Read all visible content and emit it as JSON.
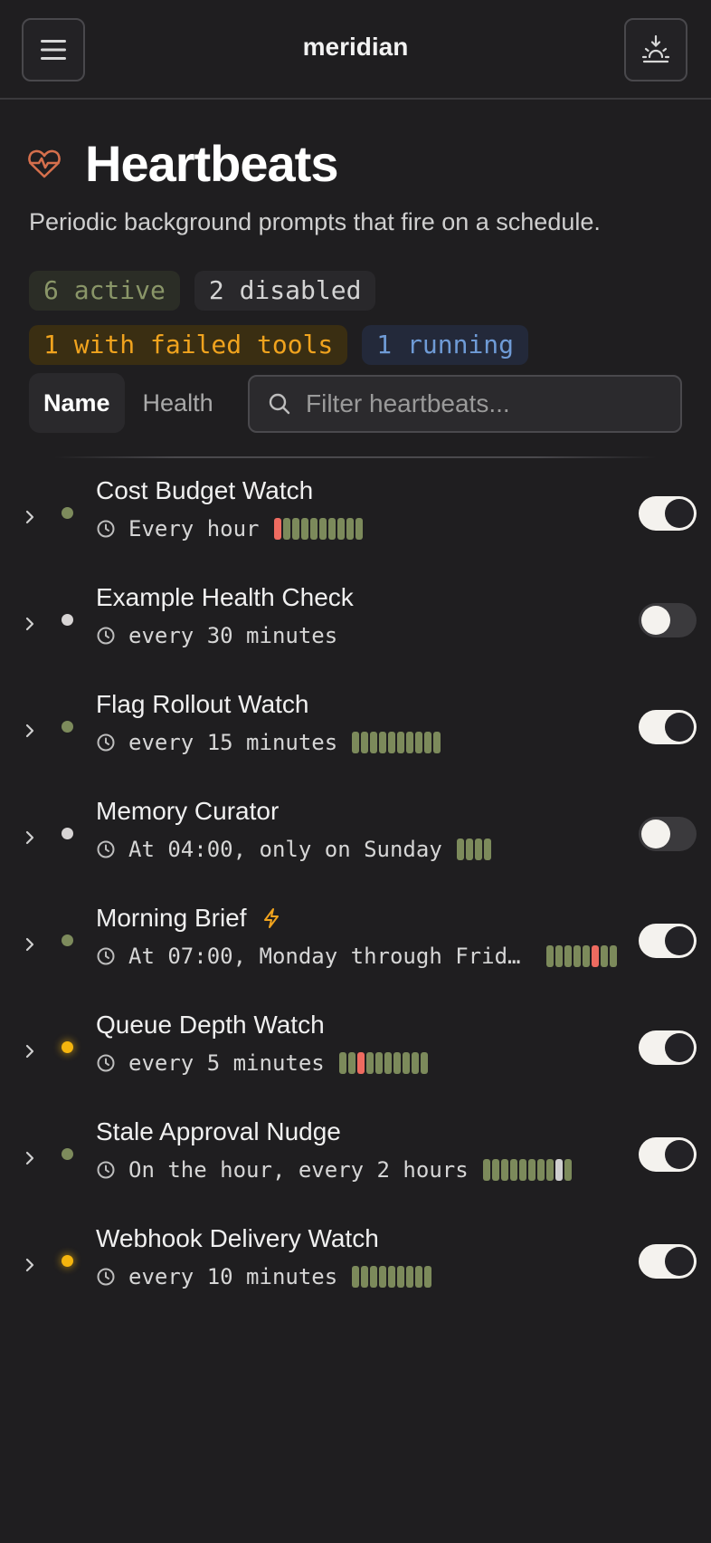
{
  "app": {
    "title": "meridian"
  },
  "page": {
    "title": "Heartbeats",
    "subtitle": "Periodic background prompts that fire on a schedule."
  },
  "badges": {
    "active": "6 active",
    "disabled": "2 disabled",
    "failed": "1 with failed tools",
    "running": "1 running"
  },
  "sort": {
    "name_label": "Name",
    "health_label": "Health",
    "selected": "Name"
  },
  "search": {
    "placeholder": "Filter heartbeats..."
  },
  "colors": {
    "ok": "#7c8a5b",
    "fail": "#ee6b60",
    "skip": "#cfcfcf",
    "failed_tools": "#f0a31e",
    "running": "#6f9bd6"
  },
  "heartbeats": [
    {
      "name": "Cost Budget Watch",
      "schedule": "Every hour",
      "enabled": true,
      "status": "ok",
      "history": [
        "fail",
        "ok",
        "ok",
        "ok",
        "ok",
        "ok",
        "ok",
        "ok",
        "ok",
        "ok"
      ]
    },
    {
      "name": "Example Health Check",
      "schedule": "every 30 minutes",
      "enabled": false,
      "status": "disabled",
      "history": []
    },
    {
      "name": "Flag Rollout Watch",
      "schedule": "every 15 minutes",
      "enabled": true,
      "status": "ok",
      "history": [
        "ok",
        "ok",
        "ok",
        "ok",
        "ok",
        "ok",
        "ok",
        "ok",
        "ok",
        "ok"
      ]
    },
    {
      "name": "Memory Curator",
      "schedule": "At 04:00, only on Sunday",
      "enabled": false,
      "status": "disabled",
      "history": [
        "ok",
        "ok",
        "ok",
        "ok"
      ]
    },
    {
      "name": "Morning Brief",
      "schedule": "At 07:00, Monday through Frid…",
      "enabled": true,
      "status": "ok",
      "badge_icon": "bolt-icon",
      "history": [
        "ok",
        "ok",
        "ok",
        "ok",
        "ok",
        "fail",
        "ok",
        "ok"
      ]
    },
    {
      "name": "Queue Depth Watch",
      "schedule": "every 5 minutes",
      "enabled": true,
      "status": "failed-tools",
      "history": [
        "ok",
        "ok",
        "fail",
        "ok",
        "ok",
        "ok",
        "ok",
        "ok",
        "ok",
        "ok"
      ]
    },
    {
      "name": "Stale Approval Nudge",
      "schedule": "On the hour, every 2 hours",
      "enabled": true,
      "status": "ok",
      "history": [
        "ok",
        "ok",
        "ok",
        "ok",
        "ok",
        "ok",
        "ok",
        "ok",
        "skip",
        "ok"
      ]
    },
    {
      "name": "Webhook Delivery Watch",
      "schedule": "every 10 minutes",
      "enabled": true,
      "status": "running",
      "history": [
        "ok",
        "ok",
        "ok",
        "ok",
        "ok",
        "ok",
        "ok",
        "ok",
        "ok"
      ]
    }
  ]
}
